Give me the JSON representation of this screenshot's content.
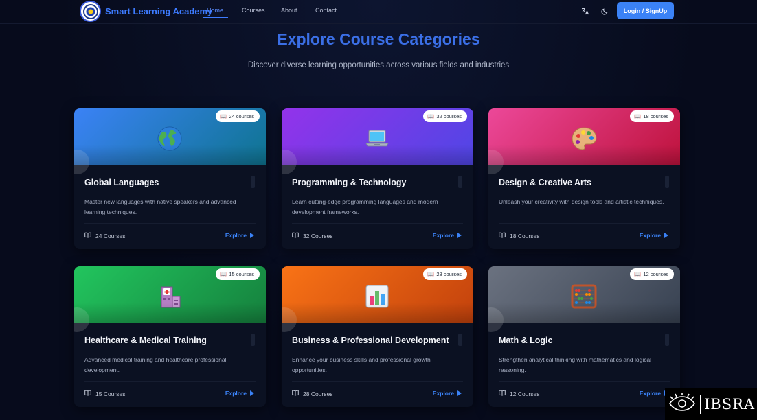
{
  "nav": {
    "brand": "Smart Learning Academy",
    "links": [
      {
        "label": "Home",
        "active": true
      },
      {
        "label": "Courses",
        "active": false
      },
      {
        "label": "About",
        "active": false
      },
      {
        "label": "Contact",
        "active": false
      }
    ],
    "translate_icon": "translate-icon",
    "theme_icon": "moon-icon",
    "login_label": "Login / SignUp"
  },
  "hero": {
    "title": "Explore Course Categories",
    "subtitle": "Discover diverse learning opportunities across various fields and industries"
  },
  "categories": [
    {
      "title": "Global Languages",
      "badge": "24 courses",
      "description": "Master new languages with native speakers and advanced learning techniques.",
      "count": "24 Courses",
      "explore": "Explore",
      "icon": "globe-icon",
      "colors": [
        "#3b82f6",
        "#0e7490"
      ]
    },
    {
      "title": "Programming & Technology",
      "badge": "32 courses",
      "description": "Learn cutting-edge programming languages and modern development frameworks.",
      "count": "32 Courses",
      "explore": "Explore",
      "icon": "laptop-icon",
      "colors": [
        "#9333ea",
        "#4f46e5"
      ]
    },
    {
      "title": "Design & Creative Arts",
      "badge": "18 courses",
      "description": "Unleash your creativity with design tools and artistic techniques.",
      "count": "18 Courses",
      "explore": "Explore",
      "icon": "palette-icon",
      "colors": [
        "#ec4899",
        "#be123c"
      ]
    },
    {
      "title": "Healthcare & Medical Training",
      "badge": "15 courses",
      "description": "Advanced medical training and healthcare professional development.",
      "count": "15 Courses",
      "explore": "Explore",
      "icon": "hospital-icon",
      "colors": [
        "#22c55e",
        "#15803d"
      ]
    },
    {
      "title": "Business & Professional Development",
      "badge": "28 courses",
      "description": "Enhance your business skills and professional growth opportunities.",
      "count": "28 Courses",
      "explore": "Explore",
      "icon": "bar-chart-icon",
      "colors": [
        "#f97316",
        "#c2410c"
      ]
    },
    {
      "title": "Math & Logic",
      "badge": "12 courses",
      "description": "Strengthen analytical thinking with mathematics and logical reasoning.",
      "count": "12 Courses",
      "explore": "Explore",
      "icon": "abacus-icon",
      "colors": [
        "#6b7280",
        "#374151"
      ]
    }
  ],
  "watermark": {
    "text": "IBSRA",
    "icon": "eye-icon"
  }
}
